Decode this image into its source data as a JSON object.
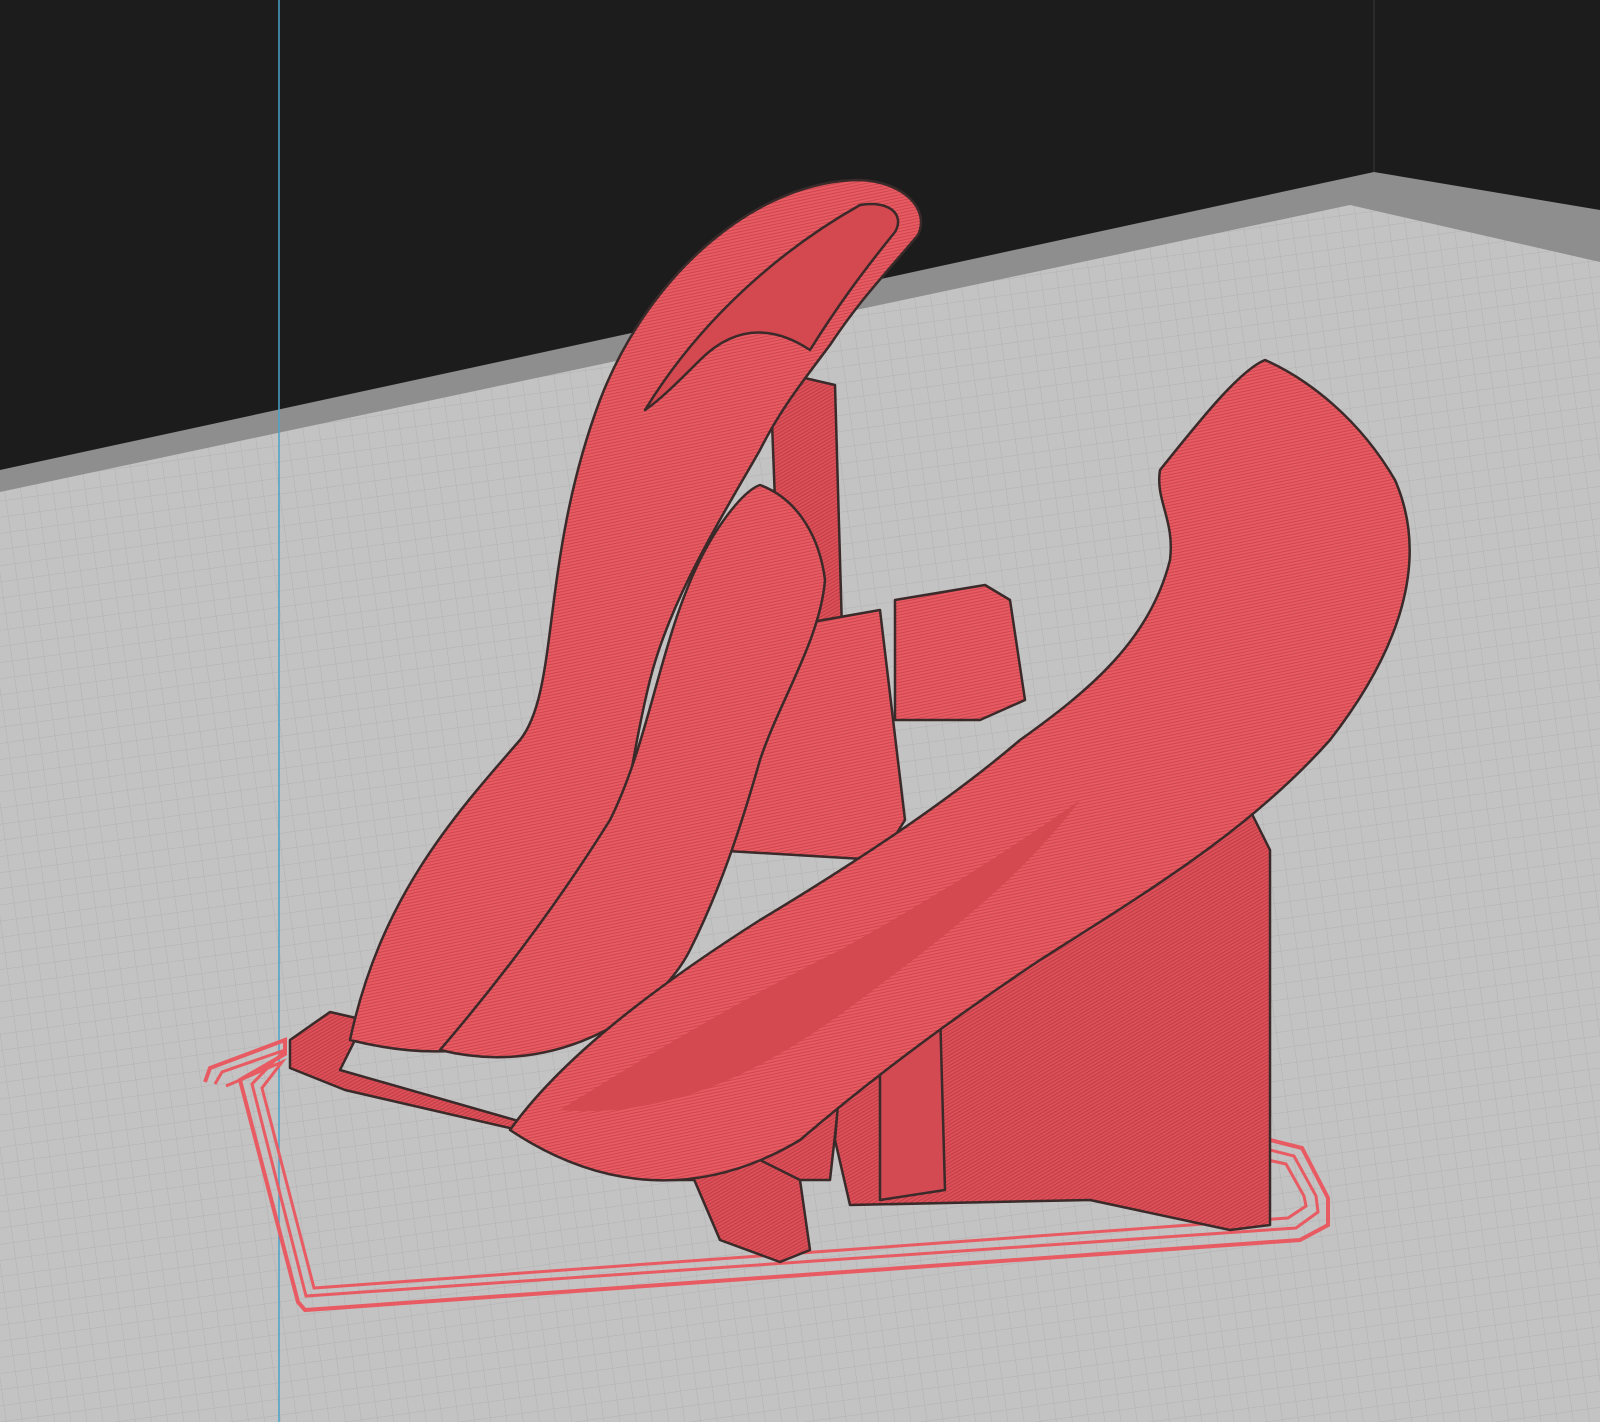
{
  "viewport": {
    "label": "",
    "colors": {
      "background": "#1c1c1c",
      "plate_surface": "#c2c2c2",
      "plate_grid": "#b3b3b3",
      "plate_edge": "#8a8a8a",
      "model": "#e85b62",
      "model_outline": "#3a2a2a",
      "axis_line": "#4aa3c9"
    },
    "icons": [
      "build-plate",
      "sliced-model",
      "brim",
      "support-structure",
      "z-axis-guide"
    ]
  }
}
